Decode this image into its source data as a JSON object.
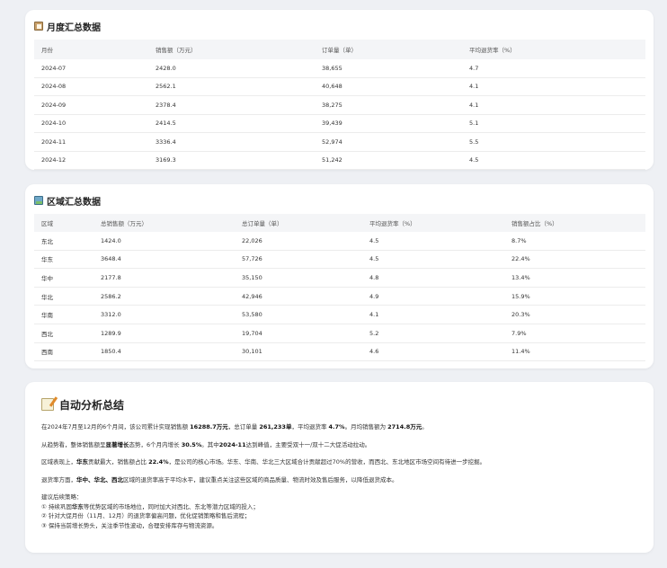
{
  "monthly": {
    "title": "月度汇总数据",
    "headers": [
      "月份",
      "销售额（万元）",
      "订单量（单）",
      "平均退货率（%）"
    ],
    "rows": [
      [
        "2024-07",
        "2428.0",
        "38,655",
        "4.7"
      ],
      [
        "2024-08",
        "2562.1",
        "40,648",
        "4.1"
      ],
      [
        "2024-09",
        "2378.4",
        "38,275",
        "4.1"
      ],
      [
        "2024-10",
        "2414.5",
        "39,439",
        "5.1"
      ],
      [
        "2024-11",
        "3336.4",
        "52,974",
        "5.5"
      ],
      [
        "2024-12",
        "3169.3",
        "51,242",
        "4.5"
      ]
    ]
  },
  "region": {
    "title": "区域汇总数据",
    "headers": [
      "区域",
      "总销售额（万元）",
      "总订单量（单）",
      "平均退货率（%）",
      "销售额占比（%）"
    ],
    "rows": [
      [
        "东北",
        "1424.0",
        "22,026",
        "4.5",
        "8.7%"
      ],
      [
        "华东",
        "3648.4",
        "57,726",
        "4.5",
        "22.4%"
      ],
      [
        "华中",
        "2177.8",
        "35,150",
        "4.8",
        "13.4%"
      ],
      [
        "华北",
        "2586.2",
        "42,946",
        "4.9",
        "15.9%"
      ],
      [
        "华南",
        "3312.0",
        "53,580",
        "4.1",
        "20.3%"
      ],
      [
        "西北",
        "1289.9",
        "19,704",
        "5.2",
        "7.9%"
      ],
      [
        "西南",
        "1850.4",
        "30,101",
        "4.6",
        "11.4%"
      ]
    ]
  },
  "summary": {
    "title": "自动分析总结",
    "p1": {
      "a": "在2024年7月至12月的6个月间，该公司累计实现销售额 ",
      "b": "16288.7万元",
      "c": "，总订单量 ",
      "d": "261,233单",
      "e": "，平均退货率 ",
      "f": "4.7%",
      "g": "。月均销售额为 ",
      "h": "2714.8万元",
      "i": "。"
    },
    "p2": {
      "a": "从趋势看，整体销售额呈",
      "b": "显著增长",
      "c": "态势，6个月内增长 ",
      "d": "30.5%",
      "e": "。其中",
      "f": "2024-11",
      "g": "达到峰值，主要受双十一/双十二大促活动拉动。"
    },
    "p3": {
      "a": "区域表现上，",
      "b": "华东",
      "c": "贡献最大，销售额占比 ",
      "d": "22.4%",
      "e": "，是公司的核心市场。华东、华南、华北三大区域合计贡献超过70%的营收，而西北、东北地区市场空间有待进一步挖掘。"
    },
    "p4": {
      "a": "退货率方面，",
      "b": "华中、华北、西北",
      "c": "区域的退货率高于平均水平，建议重点关注这些区域的商品质量、物流时效及售后服务，以降低退货成本。"
    },
    "p5": {
      "intro": "建议后续策略：",
      "s1a": "① 持续巩固",
      "s1b": "华东",
      "s1c": "等优势区域的市场地位，同时加大对西北、东北等潜力区域的投入；",
      "s2": "② 针对大促月份（11月、12月）的退货率偏高问题，优化促销策略和售后流程；",
      "s3": "③ 保持当前增长势头，关注季节性波动，合理安排库存与物流资源。"
    }
  }
}
